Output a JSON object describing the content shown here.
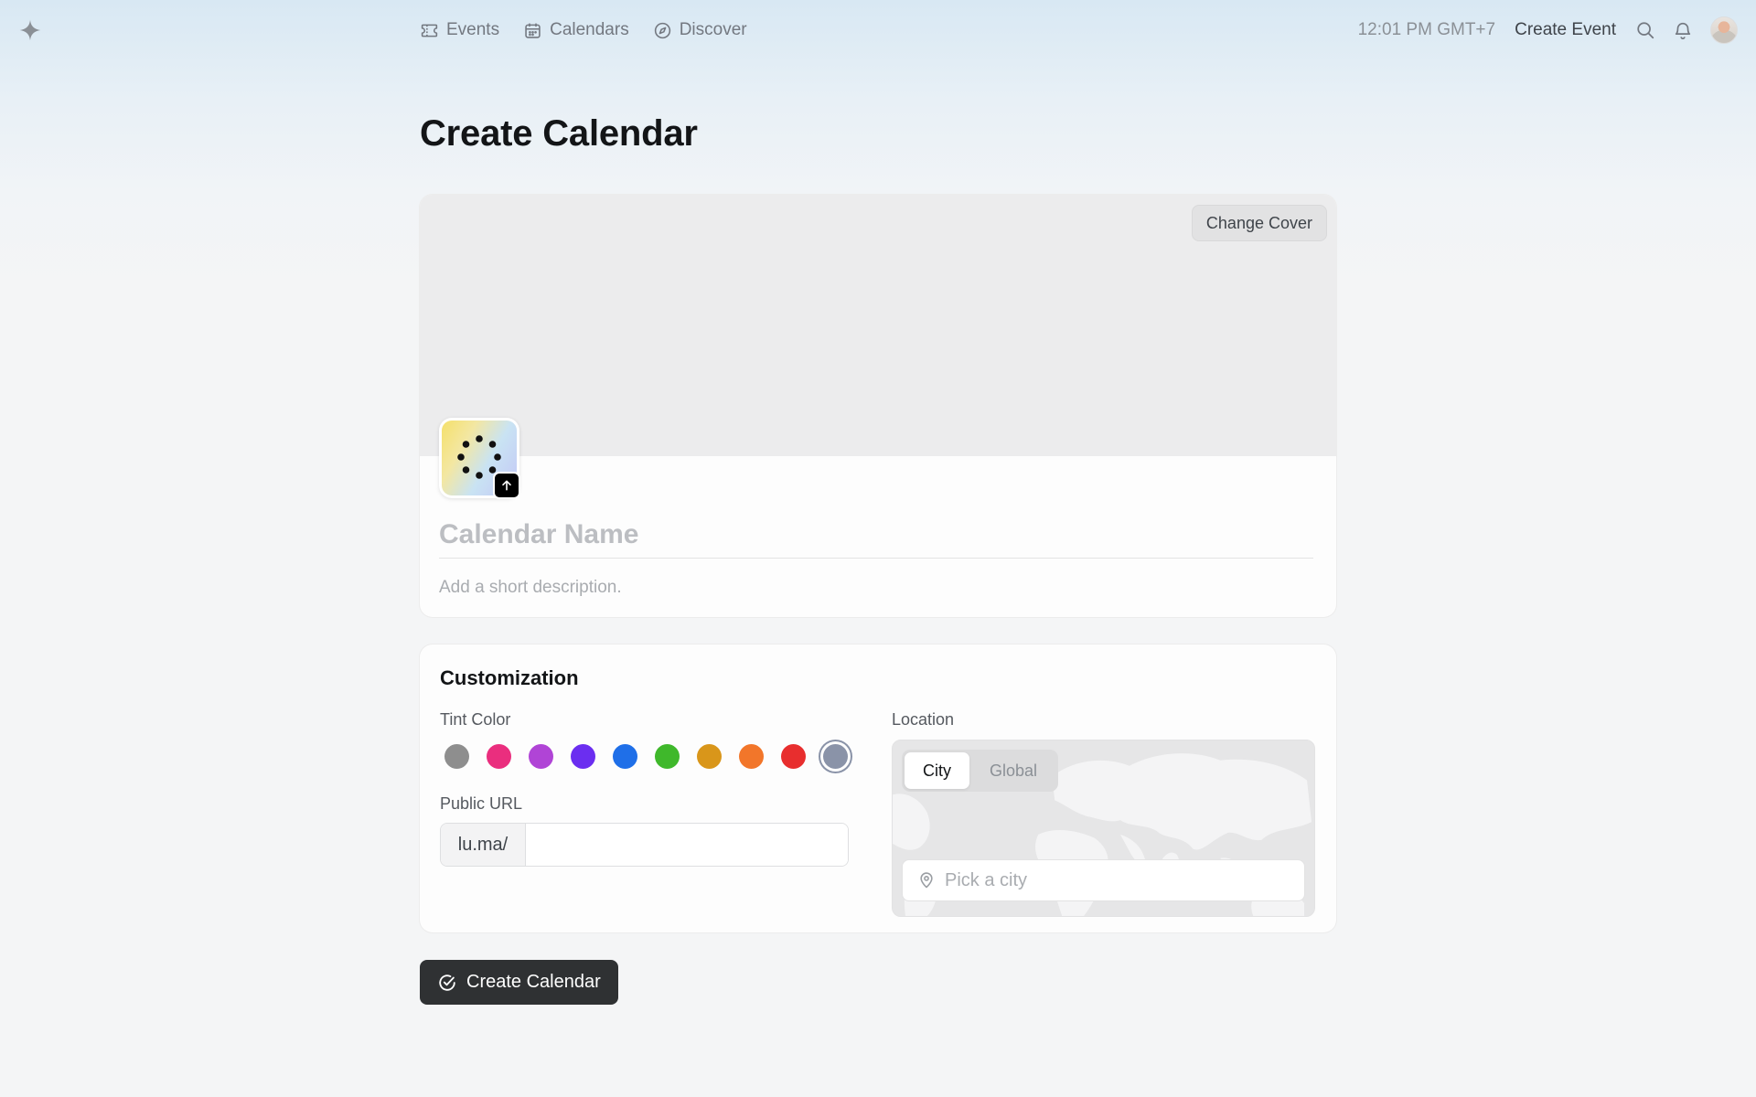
{
  "nav": {
    "logo_icon": "sparkle-icon",
    "items": [
      {
        "label": "Events",
        "icon": "ticket-icon"
      },
      {
        "label": "Calendars",
        "icon": "calendar-icon"
      },
      {
        "label": "Discover",
        "icon": "compass-icon"
      }
    ],
    "time": "12:01 PM GMT+7",
    "create_event": "Create Event"
  },
  "page": {
    "title": "Create Calendar"
  },
  "cover": {
    "change_cover_label": "Change Cover"
  },
  "calendar": {
    "name_placeholder": "Calendar Name",
    "description_placeholder": "Add a short description."
  },
  "customization": {
    "title": "Customization",
    "tint_label": "Tint Color",
    "tint_colors": [
      "#8e8e8e",
      "#ea2e7e",
      "#b044d6",
      "#6b2ef0",
      "#1f6fe8",
      "#3fb82b",
      "#d9961a",
      "#f2762a",
      "#e82e2e",
      "#8a93a8"
    ],
    "selected_tint": 9,
    "url_label": "Public URL",
    "url_prefix": "lu.ma/",
    "url_value": "",
    "location_label": "Location",
    "location_tabs": [
      "City",
      "Global"
    ],
    "active_location_tab": "City",
    "city_placeholder": "Pick a city"
  },
  "submit": {
    "label": "Create Calendar"
  }
}
